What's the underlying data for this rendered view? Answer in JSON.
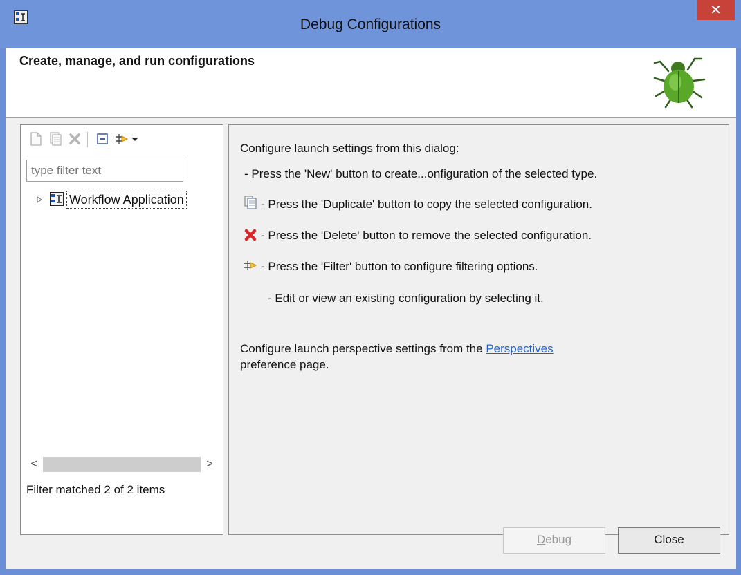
{
  "window": {
    "title": "Debug Configurations",
    "close_glyph": "✕"
  },
  "header": {
    "title": "Create, manage, and run configurations",
    "logo_icon": "bug-icon"
  },
  "left": {
    "toolbar": [
      "new-config-icon",
      "duplicate-icon",
      "delete-icon",
      "collapse-all-icon",
      "filter-icon",
      "dropdown-arrow-icon"
    ],
    "filter_placeholder": "type filter text",
    "tree": [
      {
        "label": "Workflow Application",
        "icon": "workflow-app-icon",
        "expanded": false
      }
    ],
    "scroll_left": "<",
    "scroll_right": ">",
    "status": "Filter matched 2 of 2 items"
  },
  "right": {
    "intro": "Configure launch settings from this dialog:",
    "line_new": "- Press the 'New' button to create...onfiguration of the selected type.",
    "line_duplicate": "- Press the 'Duplicate' button to copy the selected configuration.",
    "line_delete": "- Press the 'Delete' button to remove the selected configuration.",
    "line_filter": "- Press the 'Filter' button to configure filtering options.",
    "line_edit": "- Edit or view an existing configuration by selecting it.",
    "persp_before": "Configure launch perspective settings from the ",
    "persp_link": "Perspectives",
    "persp_after": "preference page."
  },
  "buttons": {
    "debug_prefix": "D",
    "debug_rest": "ebug",
    "close": "Close"
  },
  "colors": {
    "titlebar": "#6f94d9",
    "close": "#c7433a",
    "link": "#1d62d1"
  }
}
